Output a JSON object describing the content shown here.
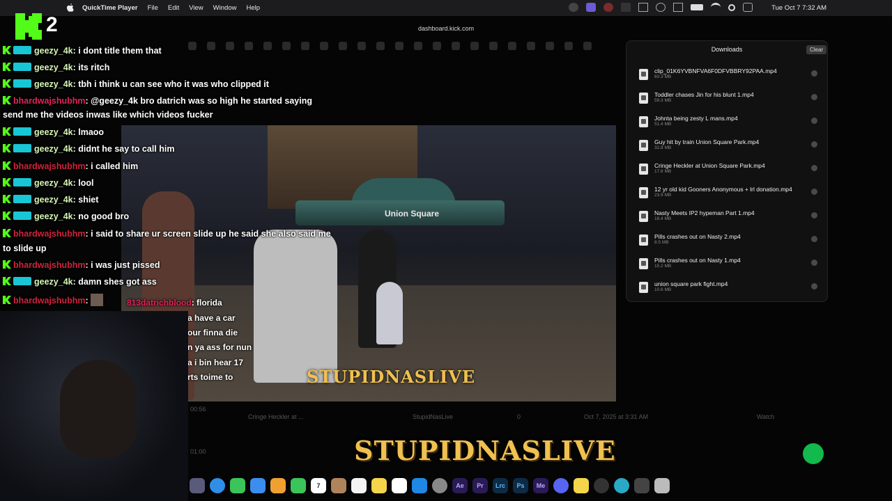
{
  "menubar": {
    "app_name": "QuickTime Player",
    "menus": [
      "File",
      "Edit",
      "View",
      "Window",
      "Help"
    ],
    "clock": "Tue Oct 7  7:32 AM"
  },
  "overlay_badge": {
    "number": "2"
  },
  "browser": {
    "url": "dashboard.kick.com"
  },
  "chat": {
    "messages": [
      {
        "user": "geezy_4k",
        "text": ": i dont title them that"
      },
      {
        "user": "geezy_4k",
        "text": ": its ritch"
      },
      {
        "user": "geezy_4k",
        "text": ": tbh i think u can see who it was who clipped it"
      },
      {
        "user": "bhardwajshubhm",
        "text": ": @geezy_4k bro datrich was so high he started saying"
      },
      {
        "user": "",
        "text": "send me the videos inwas like which videos fucker"
      },
      {
        "user": "geezy_4k",
        "text": ": lmaoo"
      },
      {
        "user": "geezy_4k",
        "text": ": didnt he say to call him"
      },
      {
        "user": "bhardwajshubhm",
        "text": ": i called him"
      },
      {
        "user": "geezy_4k",
        "text": ": lool"
      },
      {
        "user": "geezy_4k",
        "text": ": shiet"
      },
      {
        "user": "geezy_4k",
        "text": ": no good bro"
      },
      {
        "user": "bhardwajshubhm",
        "text": ": i said to share ur screen slide up he said she also said me"
      },
      {
        "user": "",
        "text": "to slide up"
      },
      {
        "user": "bhardwajshubhm",
        "text": ": i was just pissed"
      },
      {
        "user": "geezy_4k",
        "text": ": damn shes got ass"
      },
      {
        "user": "bhardwajshubhm",
        "text": ":"
      }
    ],
    "nested": {
      "user": "813datrichblood",
      "first": ": florida",
      "lines": [
        "a have a car",
        "our finna die",
        "n ya ass for nun",
        "a i bin hear 17",
        "rts toime to"
      ]
    }
  },
  "video": {
    "sign_text": "Union Square",
    "watermark": "STUPIDNASLIVE"
  },
  "downloads": {
    "title": "Downloads",
    "clear_label": "Clear",
    "items": [
      {
        "name": "clip_01K6YVBNFVA6F0DFVBBRY92PAA.mp4",
        "size": "60.3 MB"
      },
      {
        "name": "Toddler chases Jin for his blunt 1.mp4",
        "size": "59.3 MB"
      },
      {
        "name": "Johnta being zesty L mans.mp4",
        "size": "51.4 MB"
      },
      {
        "name": "Guy hit by train Union Square Park.mp4",
        "size": "32.8 MB"
      },
      {
        "name": "Cringe Heckler at Union Square Park.mp4",
        "size": "17.8 MB"
      },
      {
        "name": "12 yr old kid Gooners Anonymous + lrl donation.mp4",
        "size": "23.9 MB"
      },
      {
        "name": "Nasty Meets IP2 hypeman Part 1.mp4",
        "size": "18.4 MB"
      },
      {
        "name": "Pills crashes out on Nasty 2.mp4",
        "size": "8.5 MB"
      },
      {
        "name": "Pills crashes out on Nasty 1.mp4",
        "size": "15.2 MB"
      },
      {
        "name": "union square park fight.mp4",
        "size": "10.6 MB"
      }
    ]
  },
  "dashboard_row": {
    "time_a": "00:56",
    "title": "Cringe Heckler at ...",
    "channel": "StupidNasLive",
    "views": "0",
    "date": "Oct 7, 2025 at 3:31 AM",
    "action": "Watch",
    "time_b": "01:00"
  },
  "bottom_watermark": "STUPIDNASLIVE",
  "dock": {
    "apps": [
      "Ae",
      "Pr",
      "Lrc",
      "Ps",
      "Me"
    ],
    "calendar_day": "7"
  }
}
